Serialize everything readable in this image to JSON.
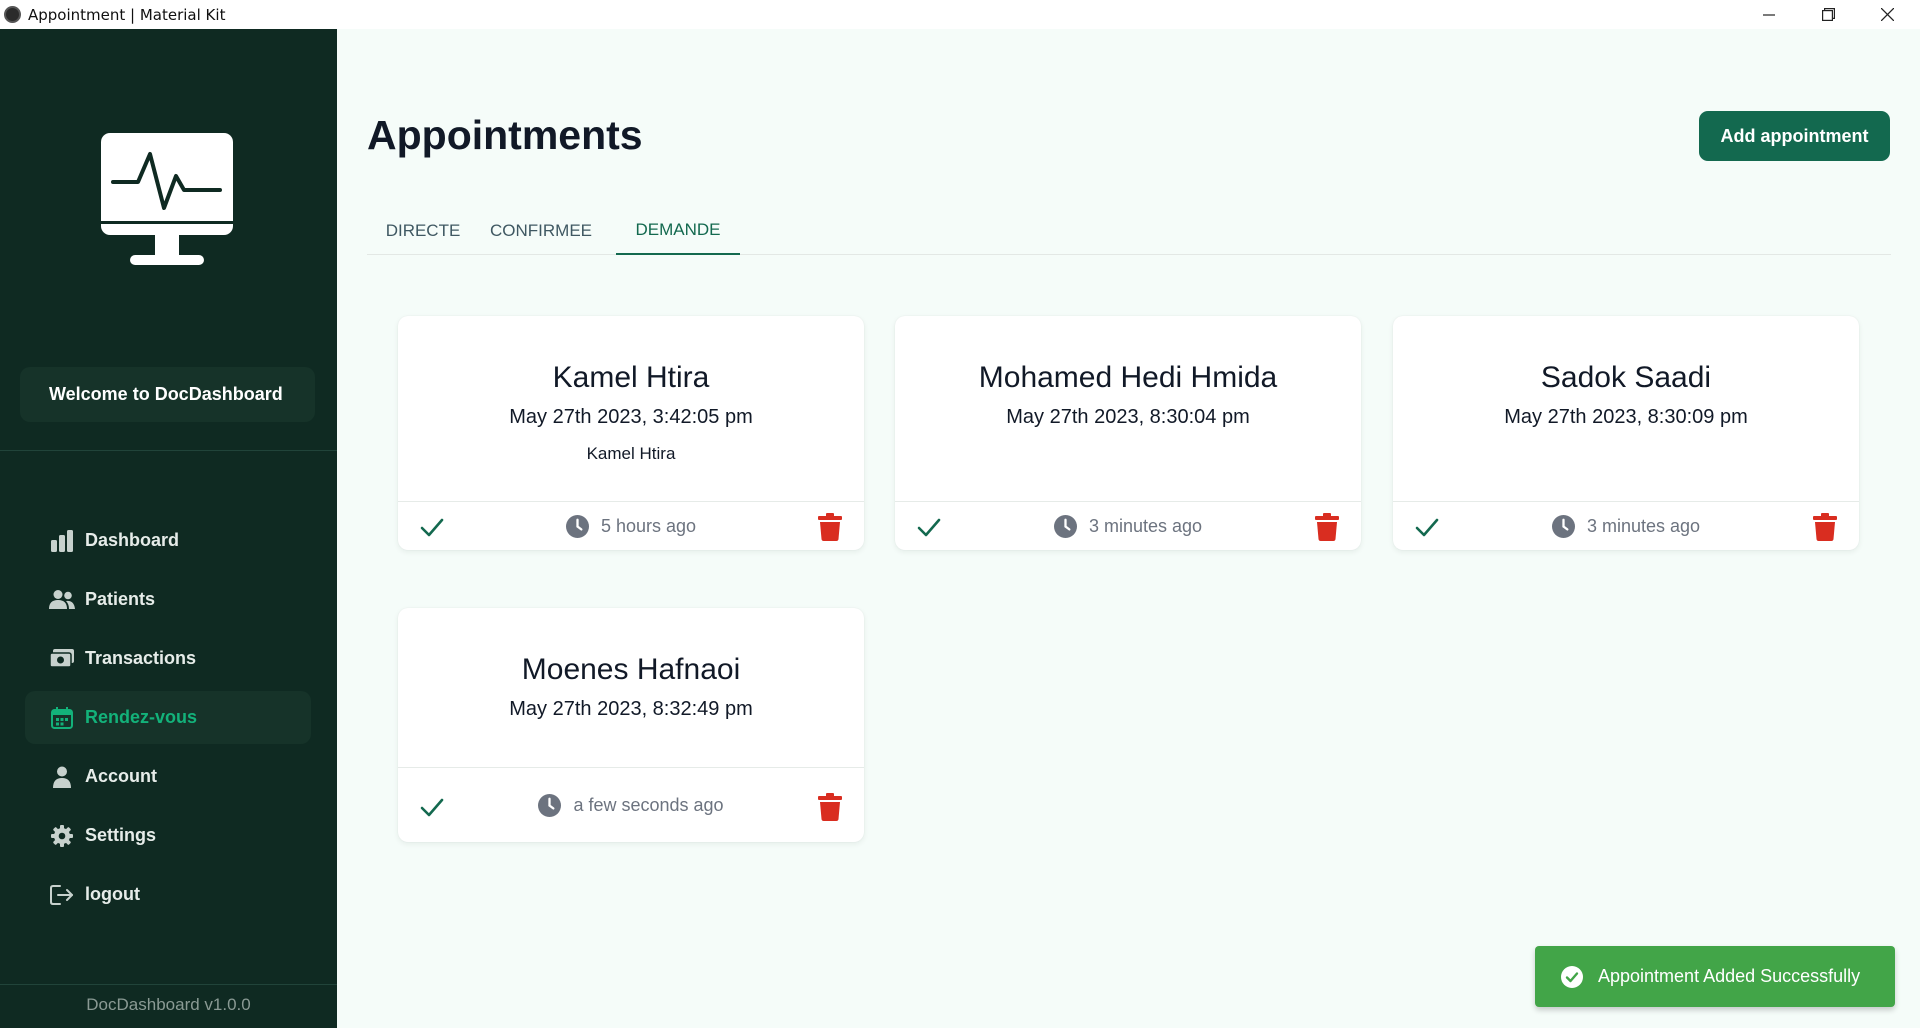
{
  "window": {
    "title": "Appointment | Material Kit"
  },
  "sidebar": {
    "welcome": "Welcome to DocDashboard",
    "items": [
      {
        "label": "Dashboard",
        "icon": "bar-chart-icon",
        "active": false
      },
      {
        "label": "Patients",
        "icon": "users-icon",
        "active": false
      },
      {
        "label": "Transactions",
        "icon": "money-icon",
        "active": false
      },
      {
        "label": "Rendez-vous",
        "icon": "calendar-icon",
        "active": true
      },
      {
        "label": "Account",
        "icon": "user-icon",
        "active": false
      },
      {
        "label": "Settings",
        "icon": "gear-icon",
        "active": false
      },
      {
        "label": "logout",
        "icon": "logout-icon",
        "active": false
      }
    ],
    "version": "DocDashboard v1.0.0"
  },
  "main": {
    "title": "Appointments",
    "add_button": "Add appointment",
    "tabs": [
      {
        "label": "DIRECTE",
        "active": false
      },
      {
        "label": "CONFIRMEE",
        "active": false
      },
      {
        "label": "DEMANDE",
        "active": true
      }
    ],
    "appointments": [
      {
        "name": "Kamel Htira",
        "date": "May 27th 2023, 3:42:05 pm",
        "note": "Kamel Htira",
        "ago": "5 hours ago"
      },
      {
        "name": "Mohamed Hedi Hmida",
        "date": "May 27th 2023, 8:30:04 pm",
        "note": "",
        "ago": "3 minutes ago"
      },
      {
        "name": "Sadok Saadi",
        "date": "May 27th 2023, 8:30:09 pm",
        "note": "",
        "ago": "3 minutes ago"
      },
      {
        "name": "Moenes Hafnaoi",
        "date": "May 27th 2023, 8:32:49 pm",
        "note": "",
        "ago": "a few seconds ago"
      }
    ]
  },
  "toast": {
    "message": "Appointment Added Successfully"
  },
  "colors": {
    "sidebar_bg": "#0f2a22",
    "primary": "#13694f",
    "active_nav": "#13b27a",
    "success": "#42a548",
    "danger": "#d92d20",
    "check": "#13694f"
  }
}
